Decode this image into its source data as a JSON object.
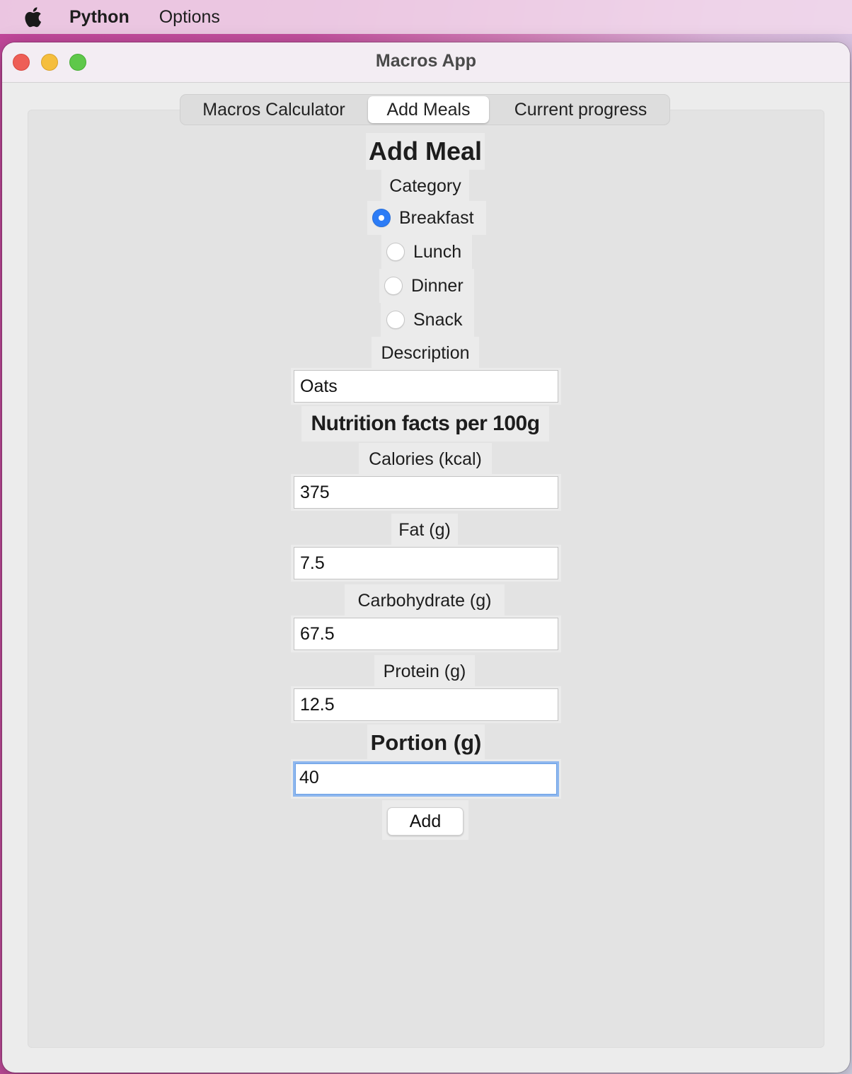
{
  "menubar": {
    "apple_icon": "apple-logo-icon",
    "app_name": "Python",
    "items": [
      "Options"
    ]
  },
  "window": {
    "title": "Macros App"
  },
  "tabs": [
    {
      "label": "Macros Calculator",
      "selected": false
    },
    {
      "label": "Add Meals",
      "selected": true
    },
    {
      "label": "Current progress",
      "selected": false
    }
  ],
  "form": {
    "title": "Add Meal",
    "category_label": "Category",
    "categories": [
      {
        "label": "Breakfast",
        "checked": true
      },
      {
        "label": "Lunch",
        "checked": false
      },
      {
        "label": "Dinner",
        "checked": false
      },
      {
        "label": "Snack",
        "checked": false
      }
    ],
    "description_label": "Description",
    "description_value": "Oats",
    "nutrition_heading": "Nutrition facts per 100g",
    "calories_label": "Calories (kcal)",
    "calories_value": "375",
    "fat_label": "Fat (g)",
    "fat_value": "7.5",
    "carb_label": "Carbohydrate (g)",
    "carb_value": "67.5",
    "protein_label": "Protein (g)",
    "protein_value": "12.5",
    "portion_label": "Portion (g)",
    "portion_value": "40",
    "add_button": "Add"
  },
  "colors": {
    "radio_selected": "#2c7cf6",
    "focus_ring": "#8eb7ee"
  }
}
